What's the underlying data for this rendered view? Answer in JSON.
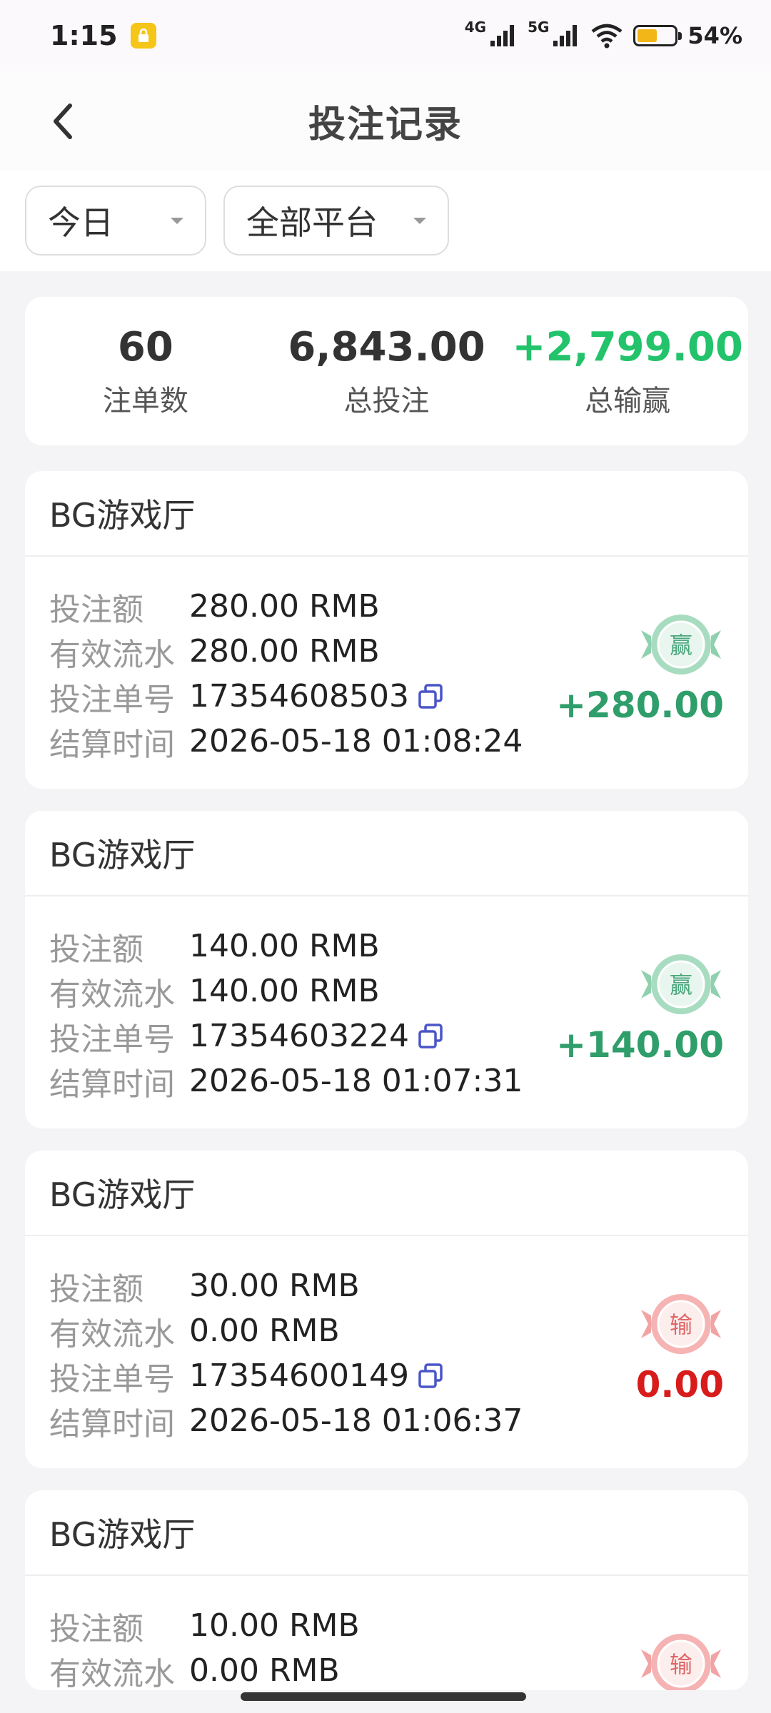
{
  "status_bar": {
    "time": "1:15",
    "net1": "4G",
    "net2": "5G",
    "battery_percent_text": "54%",
    "battery_level": 0.54
  },
  "header": {
    "title": "投注记录"
  },
  "filters": {
    "day": "今日",
    "platform": "全部平台"
  },
  "summary": {
    "count_value": "60",
    "count_label": "注单数",
    "total_bet_value": "6,843.00",
    "total_bet_label": "总投注",
    "total_win_value": "+2,799.00",
    "total_win_label": "总输赢"
  },
  "field_labels": {
    "amount": "投注额",
    "valid": "有效流水",
    "order": "投注单号",
    "time": "结算时间"
  },
  "records": [
    {
      "platform": "BG游戏厅",
      "amount": "280.00 RMB",
      "valid": "280.00 RMB",
      "order": "17354608503",
      "time": "2026-05-18 01:08:24",
      "stamp": "赢",
      "result": "+280.00",
      "status": "win"
    },
    {
      "platform": "BG游戏厅",
      "amount": "140.00 RMB",
      "valid": "140.00 RMB",
      "order": "17354603224",
      "time": "2026-05-18 01:07:31",
      "stamp": "赢",
      "result": "+140.00",
      "status": "win"
    },
    {
      "platform": "BG游戏厅",
      "amount": "30.00 RMB",
      "valid": "0.00 RMB",
      "order": "17354600149",
      "time": "2026-05-18 01:06:37",
      "stamp": "输",
      "result": "0.00",
      "status": "lose"
    },
    {
      "platform": "BG游戏厅",
      "amount": "10.00 RMB",
      "valid": "0.00 RMB",
      "stamp": "输",
      "status": "lose"
    }
  ],
  "colors": {
    "win": "#2f9e6a",
    "lose": "#d81b1b",
    "positive_total": "#22c36a",
    "copy_icon": "#4a55c8"
  }
}
